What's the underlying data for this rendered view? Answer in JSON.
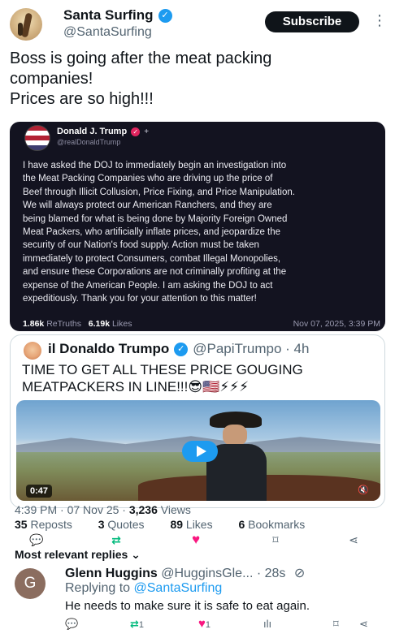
{
  "post": {
    "display_name": "Santa Surfing",
    "verified_mark": "✓",
    "handle": "@SantaSurfing",
    "subscribe_label": "Subscribe",
    "more_glyph": "⋮",
    "text_lines": [
      "Boss is going after the meat packing",
      "companies!",
      "Prices are so high!!!"
    ]
  },
  "embedded": {
    "name": "Donald J. Trump",
    "badge": "✓",
    "plus": "+",
    "handle": "@realDonaldTrump",
    "body_lines": [
      "I have asked the DOJ to immediately begin an investigation into",
      "the Meat Packing Companies who are driving up the price of",
      "Beef through Illicit Collusion, Price Fixing, and Price Manipulation.",
      "We will always protect our American Ranchers, and they are",
      "being blamed for what is being done by Majority Foreign Owned",
      "Meat Packers, who artificially inflate prices, and jeopardize the",
      "security of our Nation's food supply. Action must be taken",
      "immediately to protect Consumers, combat Illegal Monopolies,",
      "and ensure these Corporations are not criminally profiting at the",
      "expense of the American People. I am asking the DOJ to act",
      "expeditiously. Thank you for your attention to this matter!"
    ],
    "retruths_count": "1.86k",
    "retruths_label": "ReTruths",
    "likes_count": "6.19k",
    "likes_label": "Likes",
    "date": "Nov 07, 2025, 3:39 PM"
  },
  "quote": {
    "name": "il Donaldo Trumpo",
    "verified_mark": "✓",
    "handle_time": "@PapiTrumpo · 4h",
    "text_lines": [
      "TIME TO GET ALL THESE PRICE GOUGING",
      "MEATPACKERS IN LINE!!!😎🇺🇸⚡⚡⚡"
    ],
    "video_duration": "0:47",
    "mute_glyph": "🔇"
  },
  "meta": {
    "time_date": "4:39 PM · 07 Nov 25 · ",
    "views_count": "3,236",
    "views_label": " Views"
  },
  "stats": [
    {
      "count": "35",
      "label": "Reposts"
    },
    {
      "count": "3",
      "label": "Quotes"
    },
    {
      "count": "89",
      "label": "Likes"
    },
    {
      "count": "6",
      "label": "Bookmarks"
    }
  ],
  "actions": {
    "reply": "💬",
    "repost": "⇄",
    "like": "♥",
    "bookmark": "⌑",
    "share": "⋖"
  },
  "replies_header": "Most relevant replies ⌄",
  "reply": {
    "avatar_letter": "G",
    "name": "Glenn Huggins",
    "handle_time": " @HugginsGle... · 28s",
    "grok_glyph": "⊘",
    "replying_prefix": "Replying to ",
    "replying_to": "@SantaSurfing",
    "text": "He needs to make sure it is safe to eat again.",
    "repost_count": "1",
    "like_count": "1",
    "views_glyph": "ılı"
  },
  "colors": {
    "accent": "#1d9bf0",
    "truth_card_bg": "#131320",
    "like": "#f91880",
    "repost": "#00ba7c"
  }
}
